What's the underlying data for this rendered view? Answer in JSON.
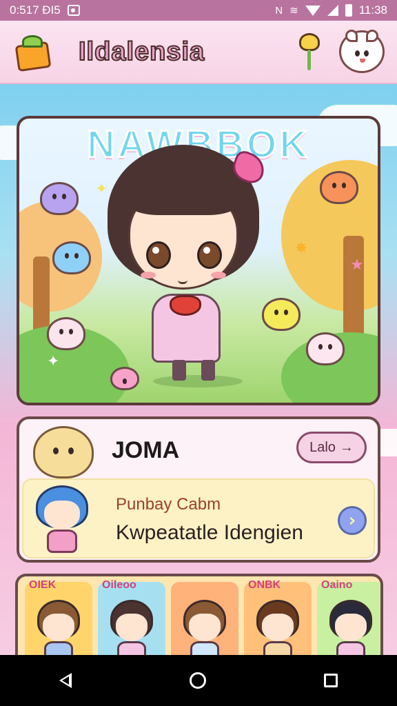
{
  "status_bar": {
    "left_text": "0:517 ĐI5",
    "time": "11:38",
    "icons": [
      "photo-icon",
      "nfc-icon",
      "vibrate-icon",
      "wifi-icon",
      "signal-icon",
      "battery-icon"
    ]
  },
  "header": {
    "title": "Ildalensia",
    "icons": [
      "gift-box-logo-icon",
      "flower-icon",
      "bear-avatar-icon"
    ]
  },
  "hero": {
    "title": "NAWBBOK"
  },
  "profile": {
    "name": "JOMA",
    "action_label": "Lalo",
    "action_arrow": "→"
  },
  "quest": {
    "title": "Punbay Cabm",
    "subtitle": "Kwpeatatle Idengien",
    "next_arrow": "›"
  },
  "characters": [
    {
      "tag": "OIEK",
      "hair": "#8a5a34",
      "bg": "#ffd56b",
      "shirt": "#a9c7f0"
    },
    {
      "tag": "Oileoo",
      "hair": "#4a3330",
      "bg": "#a6e0f0",
      "shirt": "#f4c6e4"
    },
    {
      "tag": "",
      "hair": "#8a5a34",
      "bg": "#ffb27a",
      "shirt": "#cfe8ff"
    },
    {
      "tag": "ONBK",
      "hair": "#6a3a20",
      "bg": "#ffc07a",
      "shirt": "#f6d7a7"
    },
    {
      "tag": "Oaino",
      "hair": "#2a2a3a",
      "bg": "#c8f0a0",
      "shirt": "#f4c6e4"
    }
  ],
  "colors": {
    "status_bar": "#b9739f",
    "header_bg": "#fbe4f0",
    "card_border": "#6b4a4a",
    "accent_pink": "#f06aa6",
    "title_cyan": "#6fd6f0"
  }
}
